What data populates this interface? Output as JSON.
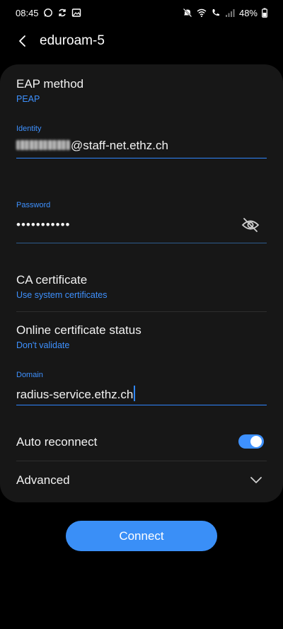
{
  "status_bar": {
    "time": "08:45",
    "battery": "48%",
    "left_icons": [
      "whatsapp-icon",
      "sync-icon",
      "gallery-icon"
    ],
    "right_icons": [
      "mute-icon",
      "wifi-icon",
      "wifi-call-icon",
      "signal-icon",
      "battery-icon"
    ]
  },
  "header": {
    "title": "eduroam-5"
  },
  "eap": {
    "title": "EAP method",
    "value": "PEAP"
  },
  "identity": {
    "label": "Identity",
    "value": "@staff-net.ethz.ch"
  },
  "password": {
    "label": "Password",
    "value": "•••••••••••"
  },
  "ca": {
    "title": "CA certificate",
    "value": "Use system certificates"
  },
  "ocsp": {
    "title": "Online certificate status",
    "value": "Don't validate"
  },
  "domain": {
    "label": "Domain",
    "value": "radius-service.ethz.ch"
  },
  "auto_reconnect": {
    "title": "Auto reconnect",
    "enabled": true
  },
  "advanced": {
    "title": "Advanced"
  },
  "connect": {
    "label": "Connect"
  },
  "colors": {
    "accent": "#3e91ff",
    "card": "#171717",
    "background": "#000000"
  }
}
